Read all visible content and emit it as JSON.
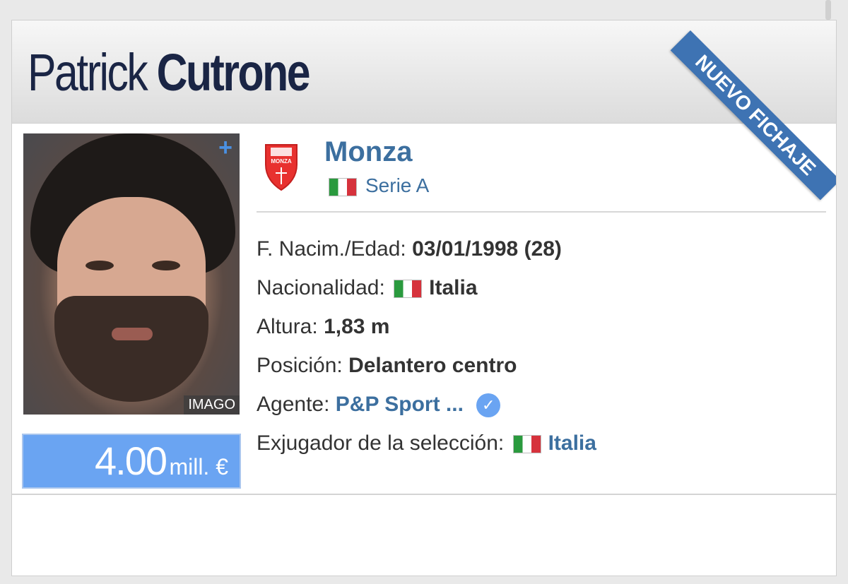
{
  "player": {
    "first_name": "Patrick",
    "last_name": "Cutrone"
  },
  "ribbon_text": "NUEVO FICHAJE",
  "photo": {
    "credit": "IMAGO",
    "plus_icon": "+"
  },
  "market_value": {
    "amount": "4.00",
    "unit": "mill. €"
  },
  "club": {
    "name": "Monza",
    "league": "Serie A",
    "crest_text": "MONZA"
  },
  "details": {
    "birth_label": "F. Nacim./Edad:",
    "birth_value": "03/01/1998 (28)",
    "nationality_label": "Nacionalidad:",
    "nationality_value": "Italia",
    "height_label": "Altura:",
    "height_value": "1,83 m",
    "position_label": "Posición:",
    "position_value": "Delantero centro",
    "agent_label": "Agente:",
    "agent_value": "P&P Sport ...",
    "national_team_label": "Exjugador de la selección:",
    "national_team_value": "Italia",
    "verified_icon": "✓"
  },
  "colors": {
    "accent_blue": "#3c6f9f",
    "value_box": "#6aa4f2",
    "ribbon": "#3e73b3",
    "name": "#1a2545"
  },
  "icons": [
    "plus-icon",
    "verified-check-icon",
    "italy-flag-icon",
    "monza-crest-icon"
  ]
}
